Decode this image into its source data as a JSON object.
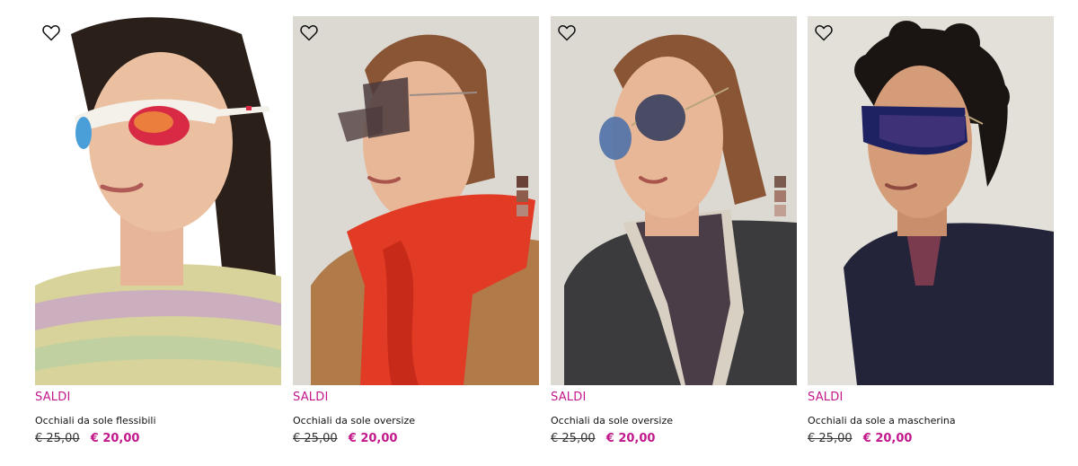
{
  "colors": {
    "accent": "#c2188c",
    "text": "#111111",
    "old_price": "#333333"
  },
  "products": [
    {
      "badge": "SALDI",
      "name": "Occhiali da sole flessibili",
      "old_price": "€ 25,00",
      "new_price": "€ 20,00",
      "favorite_icon": "heart-outline-icon",
      "lens_colors": [
        "#d92a45",
        "#f2a33b"
      ]
    },
    {
      "badge": "SALDI",
      "name": "Occhiali da sole oversize",
      "old_price": "€ 25,00",
      "new_price": "€ 20,00",
      "favorite_icon": "heart-outline-icon",
      "color_swatches": [
        "#6a4238",
        "#8e5c4a",
        "#b3877a"
      ]
    },
    {
      "badge": "SALDI",
      "name": "Occhiali da sole oversize",
      "old_price": "€ 25,00",
      "new_price": "€ 20,00",
      "favorite_icon": "heart-outline-icon",
      "color_swatches": [
        "#7a5a4f",
        "#a37a6b",
        "#c29f93"
      ]
    },
    {
      "badge": "SALDI",
      "name": "Occhiali da sole a mascherina",
      "old_price": "€ 25,00",
      "new_price": "€ 20,00",
      "favorite_icon": "heart-outline-icon",
      "lens_colors": [
        "#2a2d6e",
        "#5b3e8a"
      ]
    }
  ]
}
